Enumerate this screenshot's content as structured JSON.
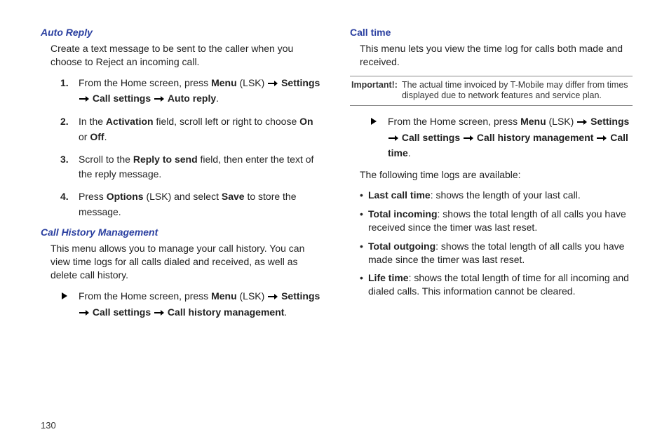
{
  "page_number": "130",
  "left": {
    "autoReply": {
      "heading": "Auto Reply",
      "intro": "Create a text message to be sent to the caller when you choose to Reject an incoming call.",
      "steps": {
        "s1": {
          "num": "1.",
          "pre": "From the Home screen, press ",
          "b1": "Menu",
          "post1": " (LSK) ",
          "b2": "Settings",
          "b3": "Call settings",
          "b4": "Auto reply",
          "dot": "."
        },
        "s2": {
          "num": "2.",
          "pre": "In the ",
          "b1": "Activation",
          "mid": " field, scroll left or right to choose ",
          "b2": "On",
          "or": " or ",
          "b3": "Off",
          "dot": "."
        },
        "s3": {
          "num": "3.",
          "pre": "Scroll to the ",
          "b1": "Reply to send",
          "post": " field, then enter the text of the reply message."
        },
        "s4": {
          "num": "4.",
          "pre": "Press ",
          "b1": "Options",
          "mid": " (LSK) and select ",
          "b2": "Save",
          "post": " to store the message."
        }
      }
    },
    "chm": {
      "heading": "Call History Management",
      "intro": "This menu allows you to manage your call history. You can view time logs for all calls dialed and received, as well as delete call history.",
      "nav": {
        "pre": "From the Home screen, press ",
        "b1": "Menu",
        "post1": " (LSK) ",
        "b2": "Settings",
        "b3": "Call settings",
        "b4": "Call history management",
        "dot": "."
      }
    }
  },
  "right": {
    "callTime": {
      "heading": "Call time",
      "intro": "This menu lets you view the time log for calls both made and received.",
      "note_label": "Important!:",
      "note_body": "The actual time invoiced by T-Mobile may differ from times displayed due to network features and service plan.",
      "nav": {
        "pre": "From the Home screen, press ",
        "b1": "Menu",
        "post1": " (LSK) ",
        "b2": "Settings",
        "b3": "Call settings",
        "b4": "Call history management",
        "b5": "Call time",
        "dot": "."
      },
      "logs_intro": "The following time logs are available:",
      "logs": {
        "l1": {
          "b": "Last call time",
          "t": ": shows the length of your last call."
        },
        "l2": {
          "b": "Total incoming",
          "t": ": shows the total length of all calls you have received since the timer was last reset."
        },
        "l3": {
          "b": "Total outgoing",
          "t": ": shows the total length of all calls you have made since the timer was last reset."
        },
        "l4": {
          "b": "Life time",
          "t": ": shows the total length of time for all incoming and dialed calls. This information cannot be cleared."
        }
      }
    }
  }
}
